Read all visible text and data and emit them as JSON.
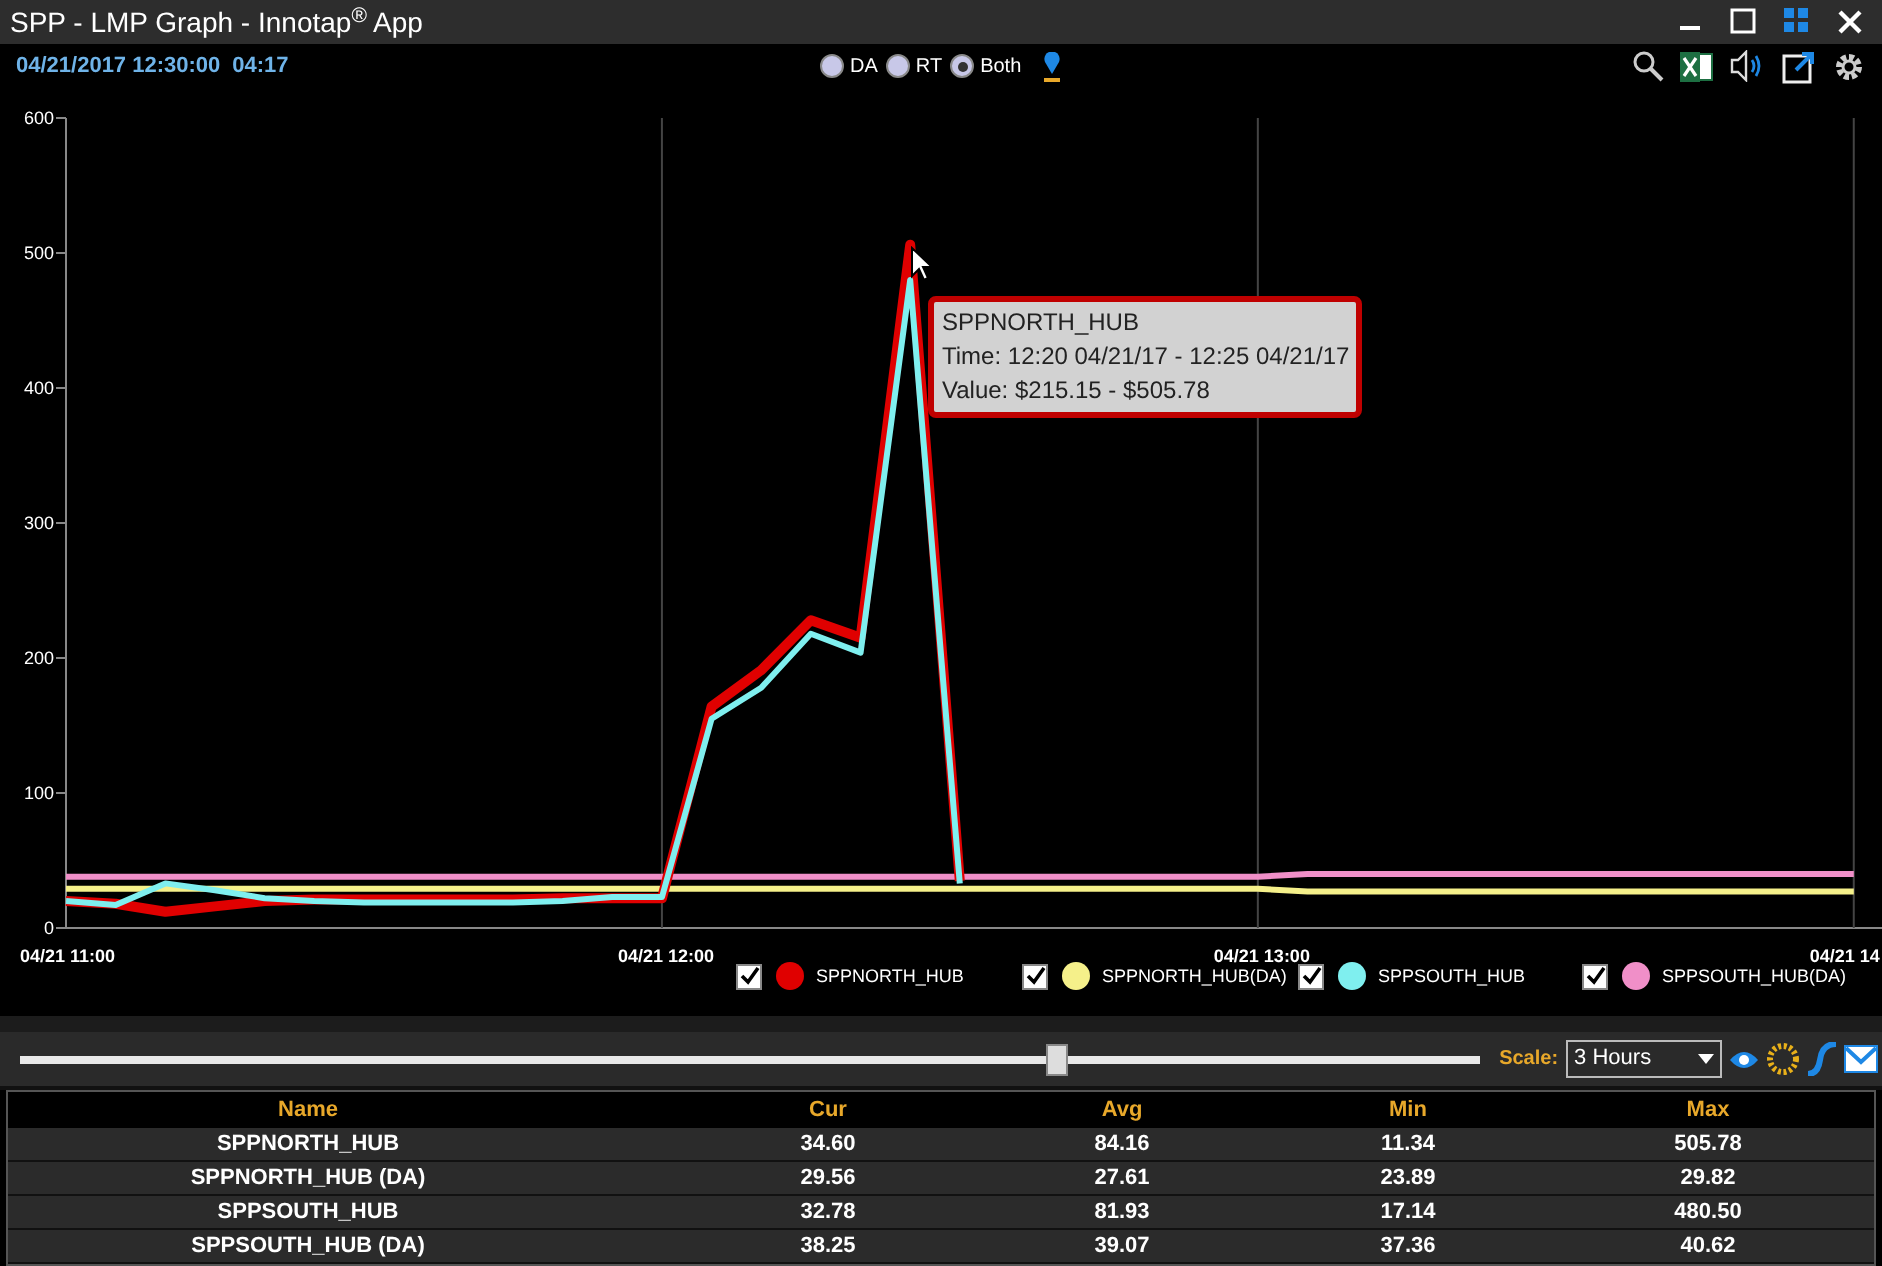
{
  "window": {
    "title": "SPP - LMP Graph - Innotap$^{®}$ App"
  },
  "toolbar": {
    "datetime": "04/21/2017 12:30:00",
    "elapsed": "04:17",
    "modes": [
      {
        "label": "DA",
        "selected": false
      },
      {
        "label": "RT",
        "selected": false
      },
      {
        "label": "Both",
        "selected": true
      }
    ]
  },
  "chart": {
    "chart_data": {
      "type": "line",
      "categories": [
        "04/21 11:00",
        null,
        null,
        null,
        null,
        null,
        null,
        null,
        null,
        null,
        null,
        null,
        "04/21 12:00",
        null,
        null,
        null,
        null,
        null,
        null,
        null,
        null,
        null,
        null,
        null,
        "04/21 13:00",
        null,
        null,
        null,
        null,
        null,
        null,
        null,
        null,
        null,
        null,
        null,
        "04/21 14"
      ],
      "yticks": [
        0,
        100,
        200,
        300,
        400,
        500,
        600
      ],
      "ylim": [
        0,
        600
      ],
      "grid": true,
      "series": [
        {
          "name": "SPPNORTH_HUB",
          "color": "#e00000",
          "values": [
            20,
            18,
            12,
            16,
            20,
            21,
            21,
            21,
            21,
            21,
            22,
            22,
            22,
            164,
            191,
            228,
            215,
            506,
            35,
            null,
            null,
            null,
            null,
            null,
            null,
            null,
            null,
            null,
            null,
            null,
            null,
            null,
            null,
            null,
            null,
            null,
            null
          ]
        },
        {
          "name": "SPPNORTH_HUB(DA)",
          "color": "#f5f08a",
          "values": [
            29,
            29,
            29,
            29,
            29,
            29,
            29,
            29,
            29,
            29,
            29,
            29,
            29,
            29,
            29,
            29,
            29,
            29,
            29,
            29,
            29,
            29,
            29,
            29,
            29,
            27,
            27,
            27,
            27,
            27,
            27,
            27,
            27,
            27,
            27,
            27,
            27
          ]
        },
        {
          "name": "SPPSOUTH_HUB",
          "color": "#7fefef",
          "values": [
            20,
            17,
            33,
            28,
            22,
            20,
            19,
            19,
            19,
            19,
            20,
            23,
            23,
            155,
            178,
            218,
            204,
            480,
            33,
            null,
            null,
            null,
            null,
            null,
            null,
            null,
            null,
            null,
            null,
            null,
            null,
            null,
            null,
            null,
            null,
            null,
            null
          ]
        },
        {
          "name": "SPPSOUTH_HUB(DA)",
          "color": "#f08fc8",
          "values": [
            38,
            38,
            38,
            38,
            38,
            38,
            38,
            38,
            38,
            38,
            38,
            38,
            38,
            38,
            38,
            38,
            38,
            38,
            38,
            38,
            38,
            38,
            38,
            38,
            38,
            40,
            40,
            40,
            40,
            40,
            40,
            40,
            40,
            40,
            40,
            40,
            40
          ]
        }
      ]
    },
    "tooltip": [
      "SPPNORTH_HUB",
      "Time: 12:20 04/21/17 - 12:25 04/21/17",
      "Value: $215.15 - $505.78"
    ],
    "legend": [
      {
        "checked": true
      },
      {
        "checked": true
      },
      {
        "checked": true
      },
      {
        "checked": true
      }
    ]
  },
  "slider": {
    "level": 0.71
  },
  "scale": {
    "label": "Scale:",
    "value": "3 Hours"
  },
  "table": {
    "columns": [
      "Name",
      "Cur",
      "Avg",
      "Min",
      "Max"
    ],
    "rows": [
      [
        "SPPNORTH_HUB",
        "34.60",
        "84.16",
        "11.34",
        "505.78"
      ],
      [
        "SPPNORTH_HUB (DA)",
        "29.56",
        "27.61",
        "23.89",
        "29.82"
      ],
      [
        "SPPSOUTH_HUB",
        "32.78",
        "81.93",
        "17.14",
        "480.50"
      ],
      [
        "SPPSOUTH_HUB (DA)",
        "38.25",
        "39.07",
        "37.36",
        "40.62"
      ]
    ]
  }
}
